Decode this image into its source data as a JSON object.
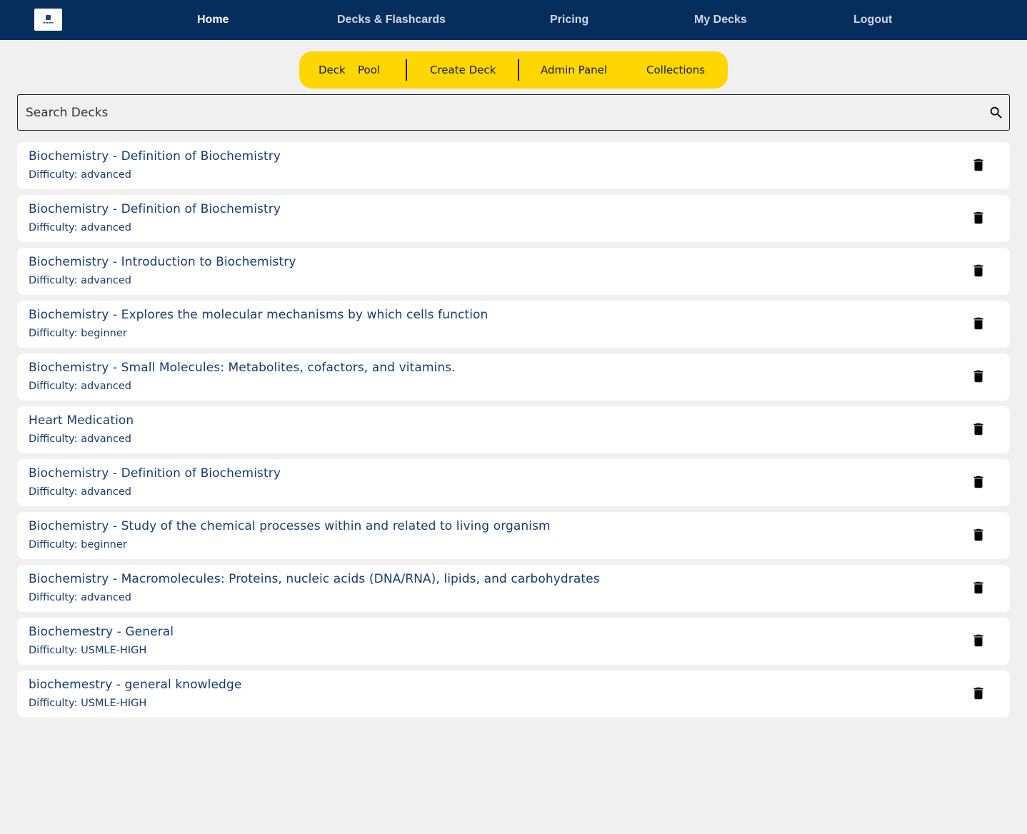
{
  "colors": {
    "nav_background": "#062e5d",
    "subnav_background": "#ffd600",
    "page_background": "#f0f0f0",
    "text_primary": "#163c6e"
  },
  "nav": {
    "logo_icon": "medical-school-logo",
    "links": [
      "Home",
      "Decks & Flashcards",
      "Pricing",
      "My Decks",
      "Logout"
    ],
    "active": "Home"
  },
  "subnav": {
    "deck_pool_word1": "Deck",
    "deck_pool_word2": "Pool",
    "create_deck": "Create Deck",
    "admin_panel": "Admin Panel",
    "collections": "Collections"
  },
  "search": {
    "placeholder": "Search Decks",
    "value": "",
    "icon": "search-icon"
  },
  "decks": [
    {
      "title": "Biochemistry - Definition of Biochemistry",
      "difficulty": "Difficulty: advanced"
    },
    {
      "title": "Biochemistry - Definition of Biochemistry",
      "difficulty": "Difficulty: advanced"
    },
    {
      "title": "Biochemistry - Introduction to Biochemistry",
      "difficulty": "Difficulty: advanced"
    },
    {
      "title": "Biochemistry - Explores the molecular mechanisms by which cells function",
      "difficulty": "Difficulty: beginner"
    },
    {
      "title": "Biochemistry - Small Molecules: Metabolites, cofactors, and vitamins.",
      "difficulty": "Difficulty: advanced"
    },
    {
      "title": "Heart Medication",
      "difficulty": "Difficulty: advanced"
    },
    {
      "title": "Biochemistry - Definition of Biochemistry",
      "difficulty": "Difficulty: advanced"
    },
    {
      "title": "Biochemistry - Study of the chemical processes within and related to living organism",
      "difficulty": "Difficulty: beginner"
    },
    {
      "title": "Biochemistry - Macromolecules: Proteins, nucleic acids (DNA/RNA), lipids, and carbohydrates",
      "difficulty": "Difficulty: advanced"
    },
    {
      "title": "Biochemestry - General",
      "difficulty": "Difficulty: USMLE-HIGH"
    },
    {
      "title": "biochemestry - general knowledge",
      "difficulty": "Difficulty: USMLE-HIGH"
    }
  ],
  "deck_action_icon": "trash-icon"
}
